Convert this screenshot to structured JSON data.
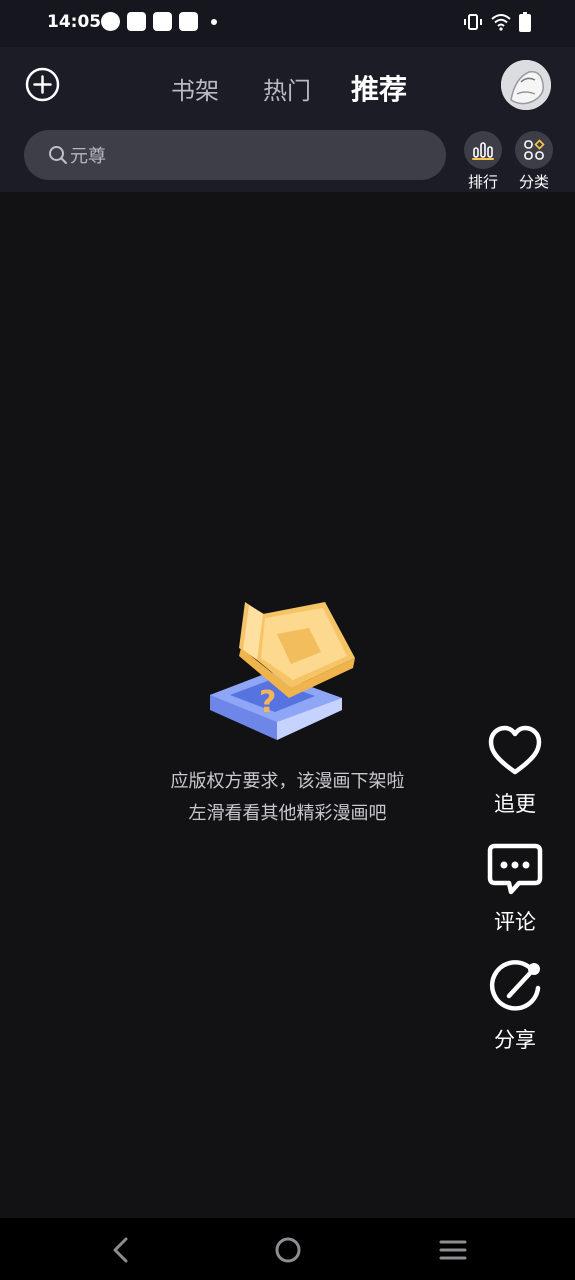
{
  "status_bar": {
    "time": "14:05"
  },
  "header": {
    "tabs": [
      {
        "label": "书架",
        "active": false
      },
      {
        "label": "热门",
        "active": false
      },
      {
        "label": "推荐",
        "active": true
      }
    ],
    "search": {
      "placeholder": "元尊"
    },
    "quick": {
      "ranking_label": "排行",
      "category_label": "分类"
    }
  },
  "empty_state": {
    "line1": "应版权方要求，该漫画下架啦",
    "line2": "左滑看看其他精彩漫画吧"
  },
  "side_actions": {
    "follow_label": "追更",
    "comment_label": "评论",
    "share_label": "分享"
  },
  "colors": {
    "background": "#121214",
    "header": "#1b1c26",
    "accent": "#f7c64a"
  }
}
